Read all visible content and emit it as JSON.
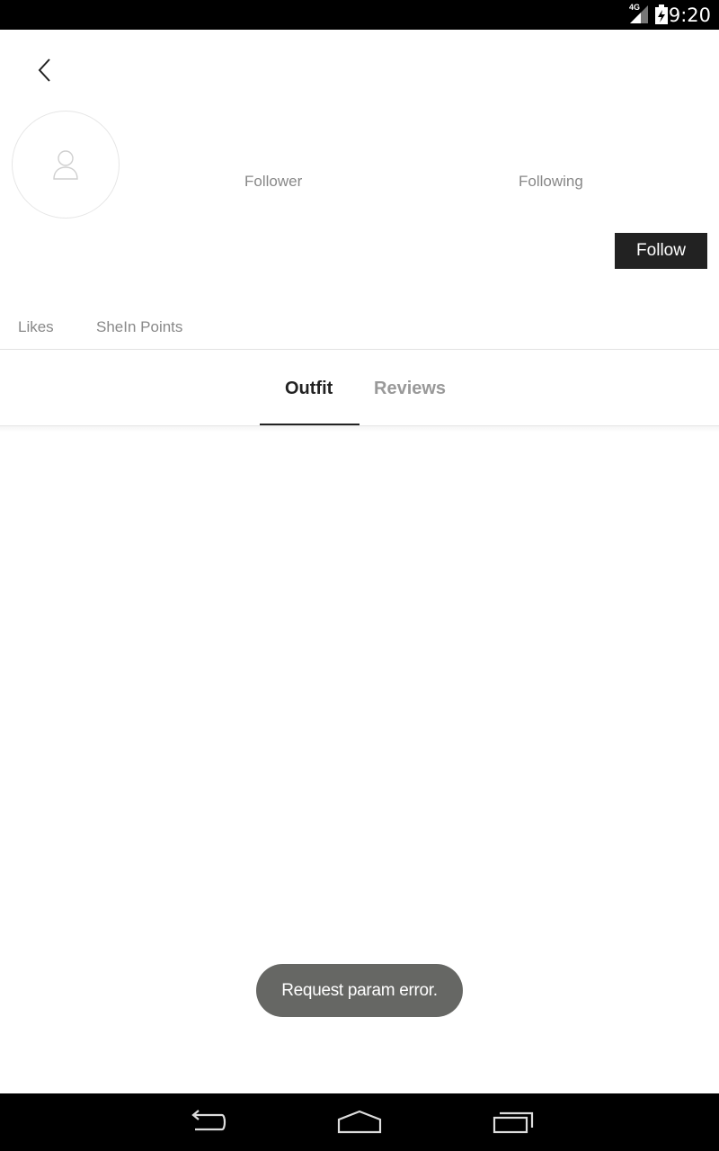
{
  "status_bar": {
    "network_label": "4G",
    "time": "9:20",
    "icons": [
      "signal-icon",
      "battery-icon"
    ]
  },
  "profile": {
    "follower_label": "Follower",
    "following_label": "Following",
    "follow_button_label": "Follow",
    "likes_label": "Likes",
    "points_label": "SheIn Points"
  },
  "tabs": [
    {
      "label": "Outfit",
      "active": true
    },
    {
      "label": "Reviews",
      "active": false
    }
  ],
  "toast": {
    "message": "Request param error."
  },
  "colors": {
    "accent_dark": "#222222",
    "muted_text": "#888888",
    "toast_bg": "#666764"
  }
}
